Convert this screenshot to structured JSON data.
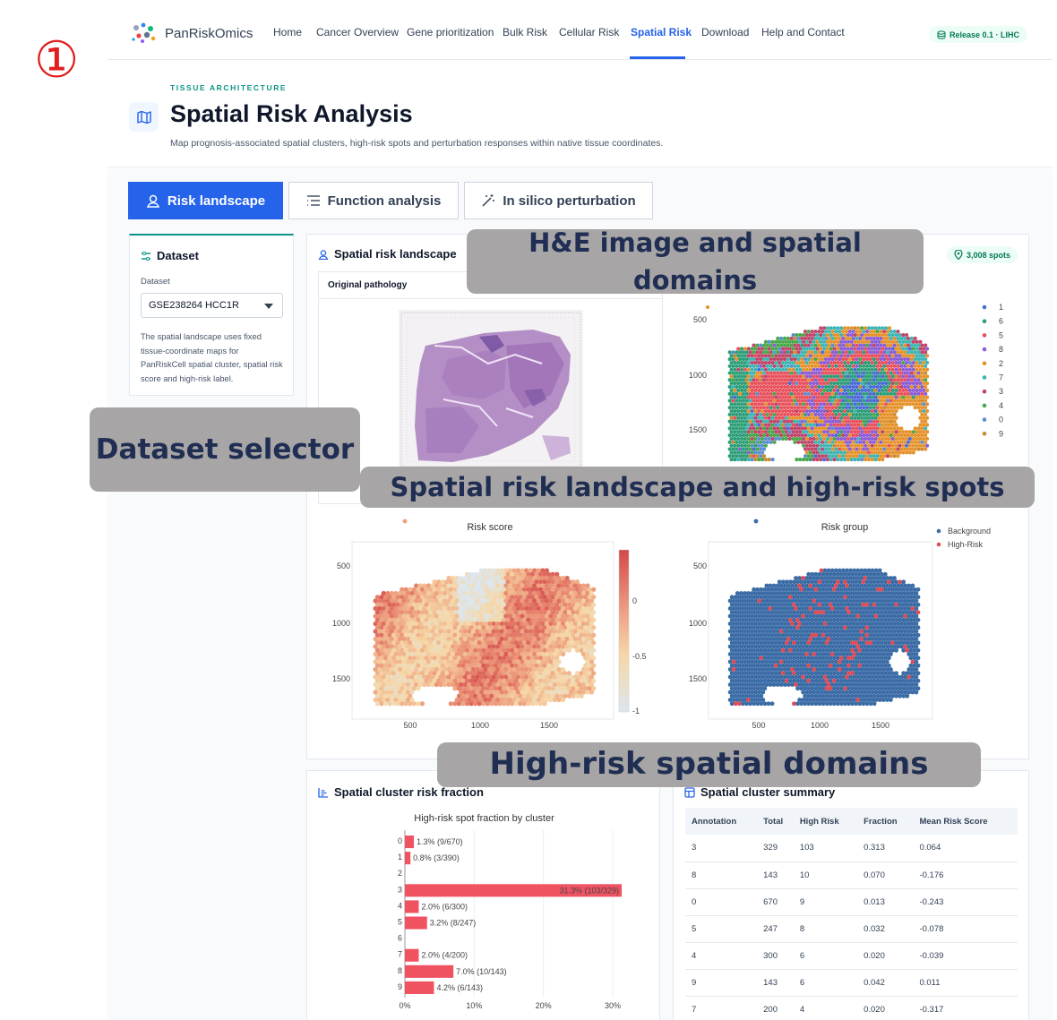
{
  "marker": "①",
  "brand": {
    "name": "PanRiskOmics"
  },
  "nav": {
    "items": [
      "Home",
      "Cancer Overview",
      "Gene prioritization",
      "Bulk Risk",
      "Cellular Risk",
      "Spatial Risk",
      "Download",
      "Help and Contact"
    ],
    "active": "Spatial Risk",
    "release": "Release 0.1 · LIHC"
  },
  "header": {
    "eyebrow": "TISSUE ARCHITECTURE",
    "title": "Spatial Risk Analysis",
    "subtitle": "Map prognosis-associated spatial clusters, high-risk spots and perturbation responses within native tissue coordinates."
  },
  "tabs": [
    {
      "label": "Risk landscape",
      "icon": "user-pin-icon",
      "active": true
    },
    {
      "label": "Function analysis",
      "icon": "list-icon",
      "active": false
    },
    {
      "label": "In silico perturbation",
      "icon": "magic-wand-icon",
      "active": false
    }
  ],
  "dataset_panel": {
    "title": "Dataset",
    "label": "Dataset",
    "selected": "GSE238264 HCC1R",
    "note": "The spatial landscape uses fixed tissue-coordinate maps for PanRiskCell spatial cluster, spatial risk score and high-risk label."
  },
  "landscape": {
    "title": "Spatial risk landscape",
    "spots_badge": "3,008 spots",
    "pathology_title": "Original pathology",
    "cluster_legend": [
      "1",
      "6",
      "5",
      "8",
      "2",
      "7",
      "3",
      "4",
      "0",
      "9"
    ],
    "cluster_colors": [
      "#4c6bd8",
      "#2e9e78",
      "#e8525d",
      "#8b5dd6",
      "#e5922b",
      "#3fb4b4",
      "#c0466a",
      "#49a849",
      "#5b8fd0",
      "#c88a32"
    ],
    "axis_y_ticks": [
      "500",
      "1000",
      "1500"
    ],
    "axis_x_ticks": [
      "500",
      "1000",
      "1500"
    ],
    "risk_score_title": "Risk score",
    "colorbar_ticks": [
      "0",
      "-0.5",
      "-1"
    ],
    "risk_group_title": "Risk group",
    "risk_group_legend": [
      {
        "label": "Background",
        "color": "#3b6ca6"
      },
      {
        "label": "High-Risk",
        "color": "#e34a52"
      }
    ]
  },
  "cluster_risk": {
    "title": "Spatial cluster risk fraction"
  },
  "summary": {
    "title": "Spatial cluster summary",
    "columns": [
      "Annotation",
      "Total",
      "High Risk",
      "Fraction",
      "Mean Risk Score"
    ],
    "rows": [
      [
        "3",
        "329",
        "103",
        "0.313",
        "0.064"
      ],
      [
        "8",
        "143",
        "10",
        "0.070",
        "-0.176"
      ],
      [
        "0",
        "670",
        "9",
        "0.013",
        "-0.243"
      ],
      [
        "5",
        "247",
        "8",
        "0.032",
        "-0.078"
      ],
      [
        "4",
        "300",
        "6",
        "0.020",
        "-0.039"
      ],
      [
        "9",
        "143",
        "6",
        "0.042",
        "0.011"
      ],
      [
        "7",
        "200",
        "4",
        "0.020",
        "-0.317"
      ]
    ]
  },
  "chart_data": {
    "type": "bar",
    "title": "High-risk spot fraction by cluster",
    "orientation": "horizontal",
    "categories": [
      "0",
      "1",
      "2",
      "3",
      "4",
      "5",
      "6",
      "7",
      "8",
      "9"
    ],
    "values": [
      1.3,
      0.8,
      0,
      31.3,
      2.0,
      3.2,
      0,
      2.0,
      7.0,
      4.2
    ],
    "labels": [
      "1.3% (9/670)",
      "0.8% (3/390)",
      "",
      "31.3% (103/329)",
      "2.0% (6/300)",
      "3.2% (8/247)",
      "",
      "2.0% (4/200)",
      "7.0% (10/143)",
      "4.2% (6/143)"
    ],
    "x_ticks": [
      "0%",
      "10%",
      "20%",
      "30%"
    ],
    "xlim": [
      0,
      32
    ],
    "color": "#ef5362"
  },
  "callouts": [
    "H&E image and spatial domains",
    "Dataset selector",
    "Spatial risk landscape and high-risk spots",
    "High-risk spatial domains"
  ]
}
